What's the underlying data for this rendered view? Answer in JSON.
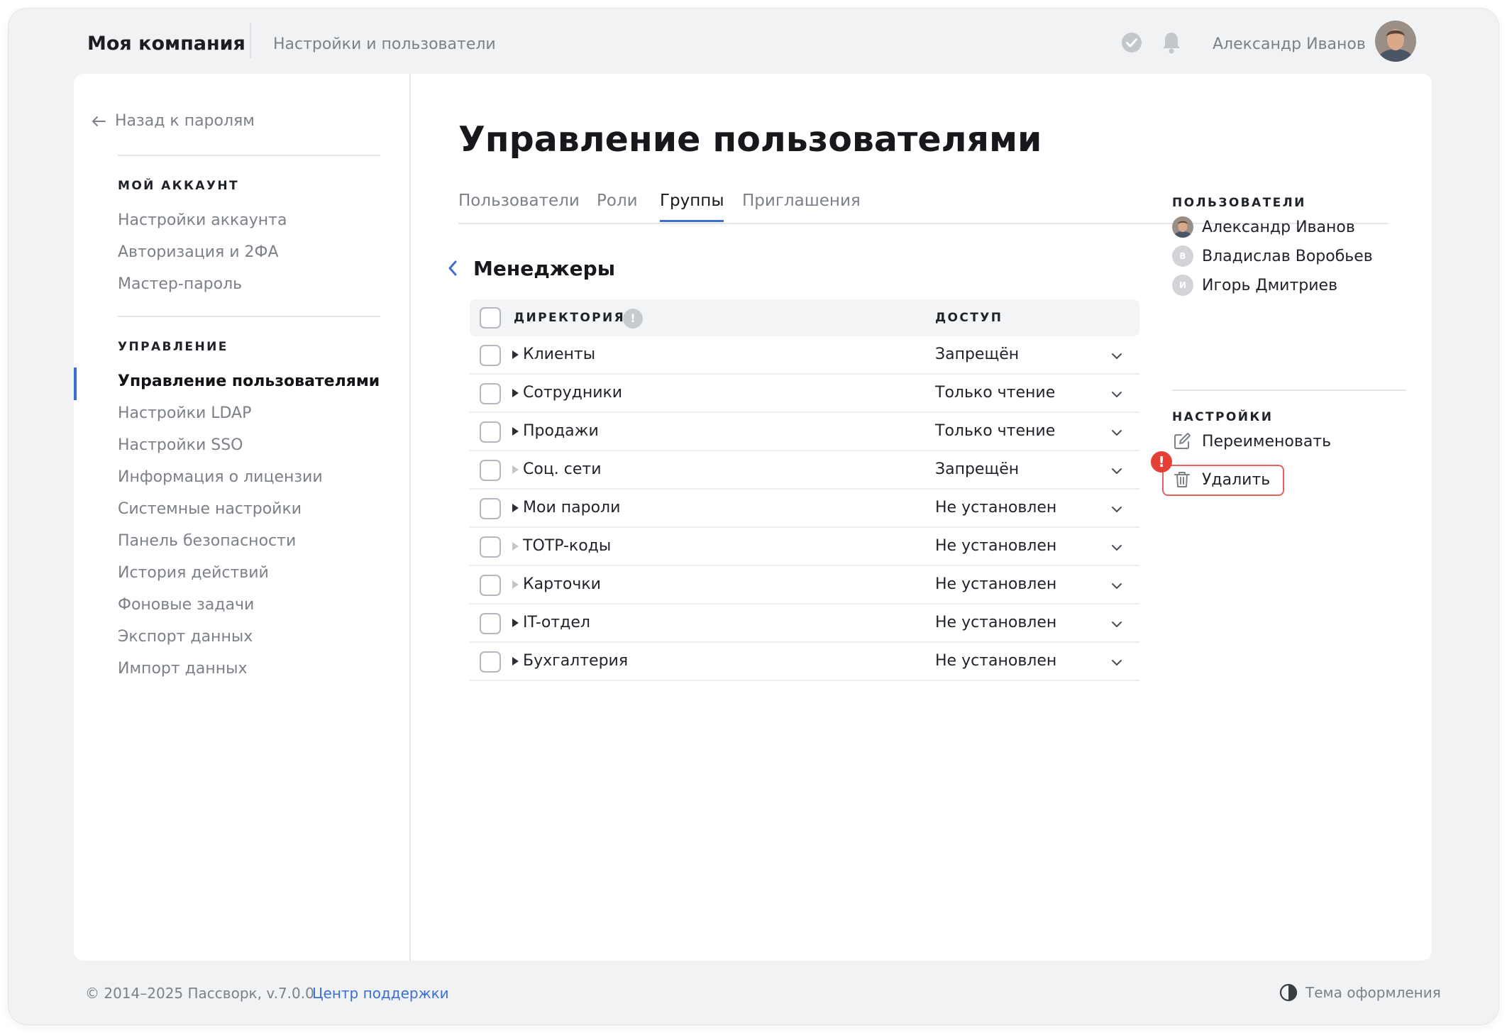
{
  "header": {
    "company": "Моя компания",
    "section": "Настройки и пользователи",
    "user_name": "Александр Иванов"
  },
  "sidebar": {
    "back_link": "Назад к паролям",
    "account_heading": "МОЙ АККАУНТ",
    "account_items": [
      "Настройки аккаунта",
      "Авторизация и 2ФА",
      "Мастер-пароль"
    ],
    "admin_heading": "УПРАВЛЕНИЕ",
    "admin_items": [
      "Управление пользователями",
      "Настройки LDAP",
      "Настройки SSO",
      "Информация о лицензии",
      "Системные настройки",
      "Панель безопасности",
      "История действий",
      "Фоновые задачи",
      "Экспорт данных",
      "Импорт данных"
    ],
    "active_item": "Управление пользователями"
  },
  "main": {
    "title": "Управление пользователями",
    "tabs": [
      "Пользователи",
      "Роли",
      "Группы",
      "Приглашения"
    ],
    "active_tab": "Группы",
    "group_name": "Менеджеры",
    "table": {
      "col_directory": "ДИРЕКТОРИЯ",
      "col_access": "ДОСТУП",
      "rows": [
        {
          "name": "Клиенты",
          "access": "Запрещён",
          "expandable": true
        },
        {
          "name": "Сотрудники",
          "access": "Только чтение",
          "expandable": true
        },
        {
          "name": "Продажи",
          "access": "Только чтение",
          "expandable": true
        },
        {
          "name": "Соц. сети",
          "access": "Запрещён",
          "expandable": false
        },
        {
          "name": "Мои пароли",
          "access": "Не установлен",
          "expandable": true
        },
        {
          "name": "TOTP-коды",
          "access": "Не установлен",
          "expandable": false
        },
        {
          "name": "Карточки",
          "access": "Не установлен",
          "expandable": false
        },
        {
          "name": "IT-отдел",
          "access": "Не установлен",
          "expandable": true
        },
        {
          "name": "Бухгалтерия",
          "access": "Не установлен",
          "expandable": true
        }
      ]
    }
  },
  "right_panel": {
    "users_heading": "ПОЛЬЗОВАТЕЛИ",
    "users": [
      {
        "name": "Александр Иванов",
        "initial": ""
      },
      {
        "name": "Владислав Воробьев",
        "initial": "В"
      },
      {
        "name": "Игорь Дмитриев",
        "initial": "И"
      }
    ],
    "settings_heading": "НАСТРОЙКИ",
    "rename_label": "Переименовать",
    "delete_label": "Удалить",
    "alert_mark": "!"
  },
  "footer": {
    "copyright": "© 2014–2025 Пассворк, v.7.0.0",
    "support_link": "Центр поддержки",
    "theme_label": "Тема оформления"
  },
  "colors": {
    "accent": "#3b6fd4",
    "danger": "#e63f36",
    "muted_text": "#7c8189"
  }
}
